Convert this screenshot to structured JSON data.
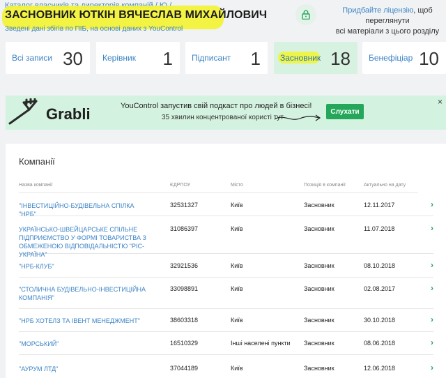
{
  "header": {
    "breadcrumb": [
      "Каталог власників та директорів компаній",
      "Ю"
    ],
    "title": "ЗАСНОВНИК ЮТКІН ВЯЧЕСЛАВ МИХАЙЛОВИЧ",
    "subtitle": "Зведені дані збігів по ПІБ, на основі даних з YouControl"
  },
  "license": {
    "link": "Придбайте ліцензію",
    "text1": ", щоб переглянути",
    "text2": "всі матеріали з цього розділу"
  },
  "stats": [
    {
      "label": "Всі записи",
      "value": "30"
    },
    {
      "label": "Керівник",
      "value": "1"
    },
    {
      "label": "Підписант",
      "value": "1"
    },
    {
      "label": "Засновник",
      "value": "18"
    },
    {
      "label": "Бенефіціар",
      "value": "10"
    }
  ],
  "banner": {
    "logo": "Grabli",
    "title": "YouControl запустив свій подкаст про людей в бізнесі!",
    "subtitle": "35 хвилин концентрованої користі тут",
    "button": "Слухати",
    "close": "×"
  },
  "companies": {
    "title": "Компанії",
    "columns": [
      "Назва компанії",
      "ЄДРПОУ",
      "Місто",
      "Позиція в компанії",
      "Актуально на дату"
    ],
    "rows": [
      {
        "name": "\"ІНВЕСТИЦІЙНО-БУДІВЕЛЬНА СПІЛКА \"НРБ\"",
        "code": "32531327",
        "city": "Київ",
        "position": "Засновник",
        "date": "12.11.2017"
      },
      {
        "name": "УКРАЇНСЬКО-ШВЕЙЦАРСЬКЕ СПІЛЬНЕ ПІДПРИЄМСТВО У ФОРМІ ТОВАРИСТВА З ОБМЕЖЕНОЮ ВІДПОВІДАЛЬНІСТЮ \"РІС-УКРАЇНА\"",
        "code": "31086397",
        "city": "Київ",
        "position": "Засновник",
        "date": "11.07.2018"
      },
      {
        "name": "\"НРБ-КЛУБ\"",
        "code": "32921536",
        "city": "Київ",
        "position": "Засновник",
        "date": "08.10.2018"
      },
      {
        "name": "\"СТОЛИЧНА БУДІВЕЛЬНО-ІНВЕСТИЦІЙНА КОМПАНІЯ\"",
        "code": "33098891",
        "city": "Київ",
        "position": "Засновник",
        "date": "02.08.2017"
      },
      {
        "name": "\"НРБ ХОТЕЛЗ ТА ІВЕНТ МЕНЕДЖМЕНТ\"",
        "code": "38603318",
        "city": "Київ",
        "position": "Засновник",
        "date": "30.10.2018"
      },
      {
        "name": "\"МОРСЬКИЙ\"",
        "code": "16510329",
        "city": "Інші населені пункти",
        "position": "Засновник",
        "date": "08.06.2018"
      },
      {
        "name": "\"АУРУМ ЛТД\"",
        "code": "37044189",
        "city": "Київ",
        "position": "Засновник",
        "date": "12.06.2018"
      }
    ]
  },
  "colors": {
    "accent": "#24a75a",
    "link": "#3d84c6",
    "highlight": "#f2f23a"
  }
}
